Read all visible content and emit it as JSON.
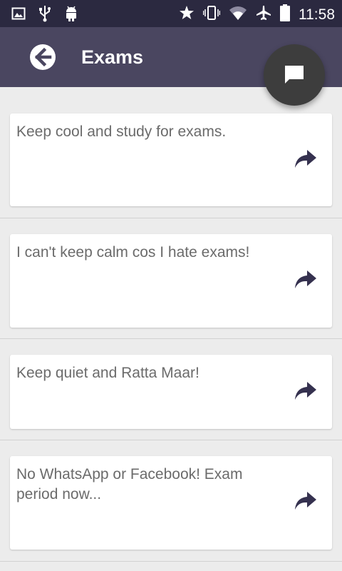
{
  "status_bar": {
    "time": "11:58",
    "icons": [
      "image-icon",
      "usb-icon",
      "android-icon",
      "star-icon",
      "vibrate-icon",
      "wifi-icon",
      "airplane-icon",
      "battery-icon"
    ]
  },
  "app_bar": {
    "title": "Exams",
    "back_icon": "back-arrow-icon",
    "fab_icon": "chat-bubble-icon"
  },
  "colors": {
    "status_bar": "#2b2940",
    "app_bar": "#4a4660",
    "fab": "#3d3d3d",
    "share_icon": "#35314f",
    "background": "#ececec"
  },
  "quotes": [
    {
      "text": "Keep cool and study for exams.",
      "action_icon": "share-icon"
    },
    {
      "text": "I can't keep calm cos I hate exams!",
      "action_icon": "share-icon"
    },
    {
      "text": "Keep quiet and Ratta Maar!",
      "action_icon": "share-icon"
    },
    {
      "text": "No WhatsApp or Facebook! Exam period now...",
      "action_icon": "share-icon"
    }
  ]
}
